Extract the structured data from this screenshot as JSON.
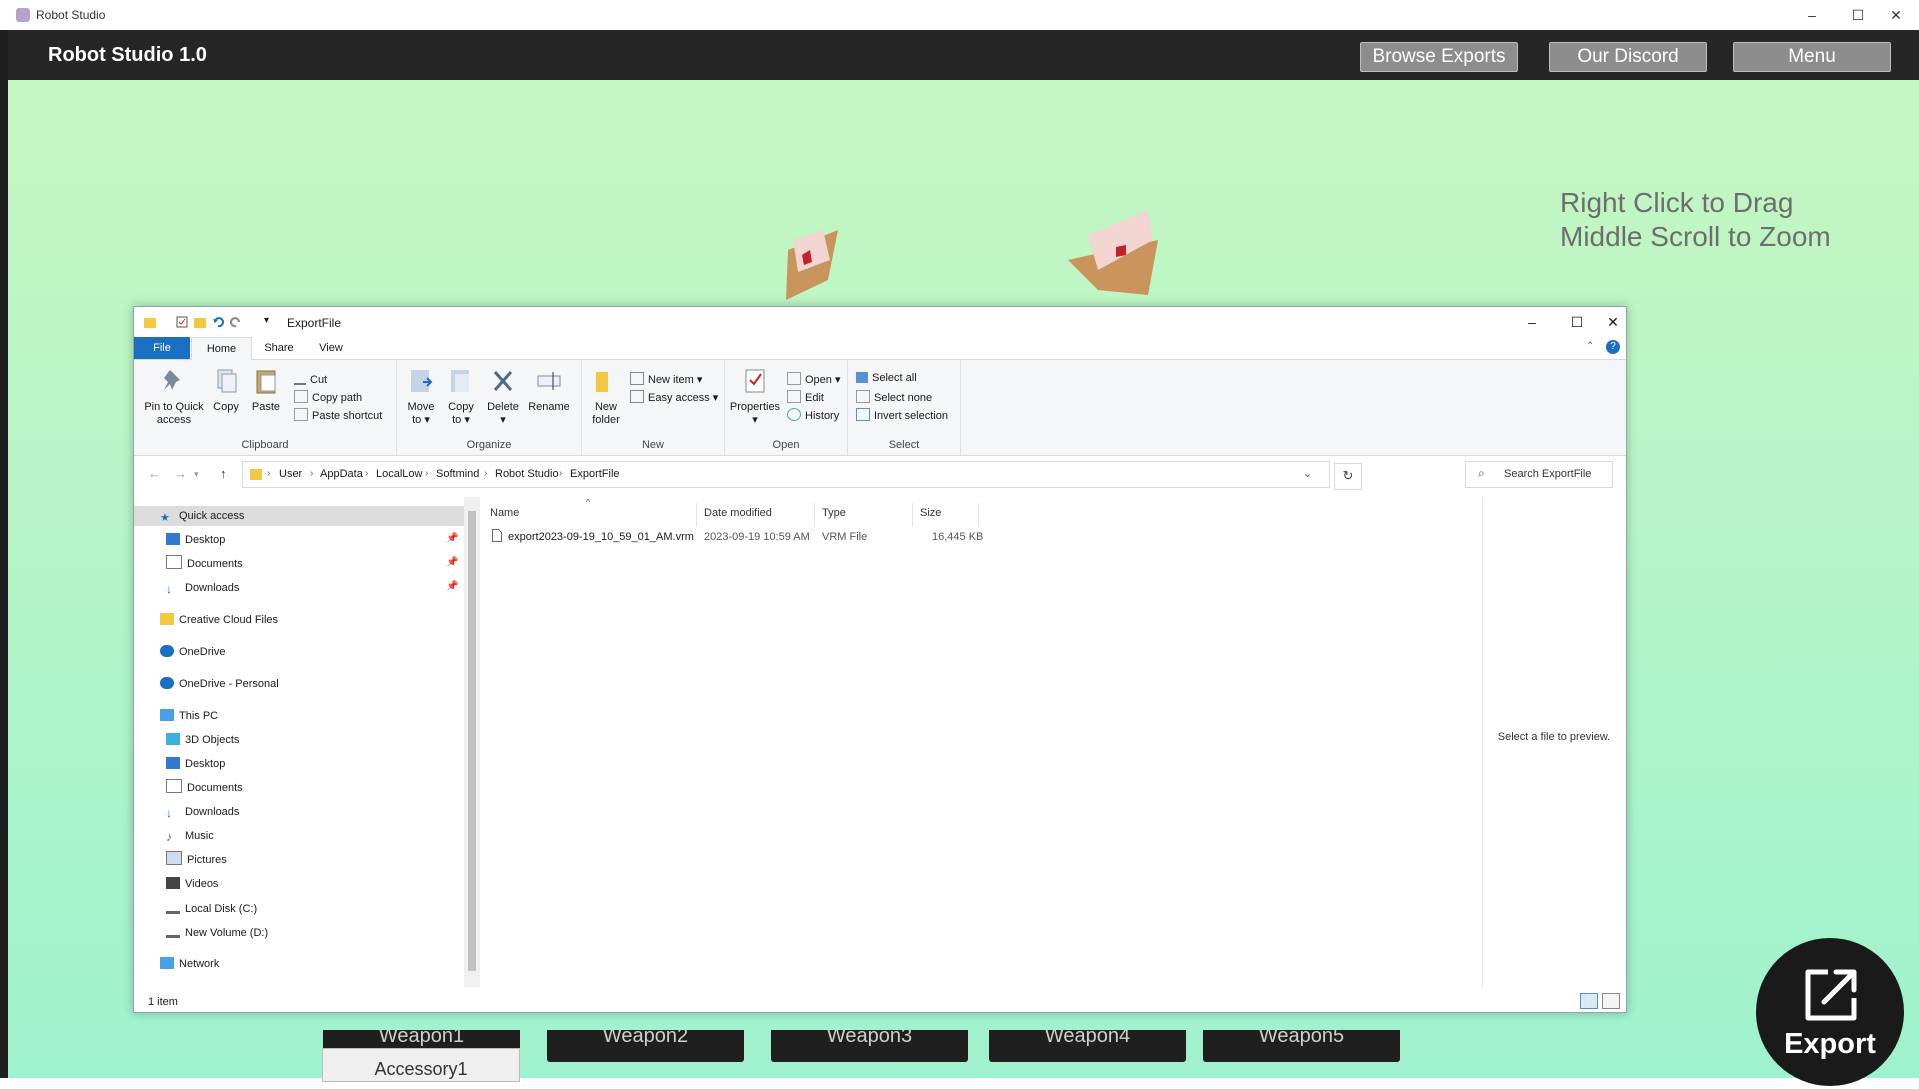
{
  "window": {
    "title": "Robot Studio",
    "controls": {
      "minimize": "–",
      "maximize": "☐",
      "close": "✕"
    }
  },
  "app": {
    "brand": "Robot Studio 1.0",
    "buttons": {
      "browse": "Browse Exports",
      "discord": "Our Discord",
      "menu": "Menu"
    },
    "hint_line1": "Right Click to Drag",
    "hint_line2": "Middle Scroll to Zoom",
    "bottom_buttons": [
      "Weapon1",
      "Weapon2",
      "Weapon3",
      "Weapon4",
      "Weapon5"
    ],
    "accessory": "Accessory1",
    "export_label": "Export",
    "colors": {
      "bg_top": "#c7f7c2",
      "bg_bottom": "#9ff2cf",
      "topbar": "#262626"
    }
  },
  "explorer": {
    "title": "ExportFile",
    "controls": {
      "minimize": "–",
      "maximize": "☐",
      "close": "✕"
    },
    "tabs": {
      "file": "File",
      "home": "Home",
      "share": "Share",
      "view": "View"
    },
    "ribbon": {
      "clipboard": {
        "title": "Clipboard",
        "pin_line1": "Pin to Quick",
        "pin_line2": "access",
        "copy": "Copy",
        "paste": "Paste",
        "cut": "Cut",
        "copy_path": "Copy path",
        "paste_shortcut": "Paste shortcut"
      },
      "organize": {
        "title": "Organize",
        "move_line1": "Move",
        "move_line2": "to ▾",
        "copy_line1": "Copy",
        "copy_line2": "to ▾",
        "delete_line1": "Delete",
        "delete_line2": "▾",
        "rename": "Rename"
      },
      "new": {
        "title": "New",
        "folder_line1": "New",
        "folder_line2": "folder",
        "new_item": "New item ▾",
        "easy_access": "Easy access ▾"
      },
      "open": {
        "title": "Open",
        "properties_line1": "Properties",
        "properties_line2": "▾",
        "open": "Open ▾",
        "edit": "Edit",
        "history": "History"
      },
      "select": {
        "title": "Select",
        "select_all": "Select all",
        "select_none": "Select none",
        "invert": "Invert selection"
      }
    },
    "address": {
      "crumbs": [
        "User",
        "AppData",
        "LocalLow",
        "Softmind",
        "Robot Studio",
        "ExportFile"
      ],
      "search_placeholder": "Search ExportFile"
    },
    "nav": {
      "quick_access": "Quick access",
      "desktop": "Desktop",
      "documents": "Documents",
      "downloads": "Downloads",
      "creative_cloud": "Creative Cloud Files",
      "onedrive": "OneDrive",
      "onedrive_personal": "OneDrive - Personal",
      "this_pc": "This PC",
      "objects3d": "3D Objects",
      "pc_desktop": "Desktop",
      "pc_documents": "Documents",
      "pc_downloads": "Downloads",
      "music": "Music",
      "pictures": "Pictures",
      "videos": "Videos",
      "local_disk": "Local Disk (C:)",
      "new_volume": "New Volume (D:)",
      "network": "Network"
    },
    "columns": {
      "name": "Name",
      "date": "Date modified",
      "type": "Type",
      "size": "Size"
    },
    "files": [
      {
        "name": "export2023-09-19_10_59_01_AM.vrm",
        "date": "2023-09-19 10:59 AM",
        "type": "VRM File",
        "size": "16,445 KB"
      }
    ],
    "preview_text": "Select a file to preview.",
    "status": "1 item"
  }
}
